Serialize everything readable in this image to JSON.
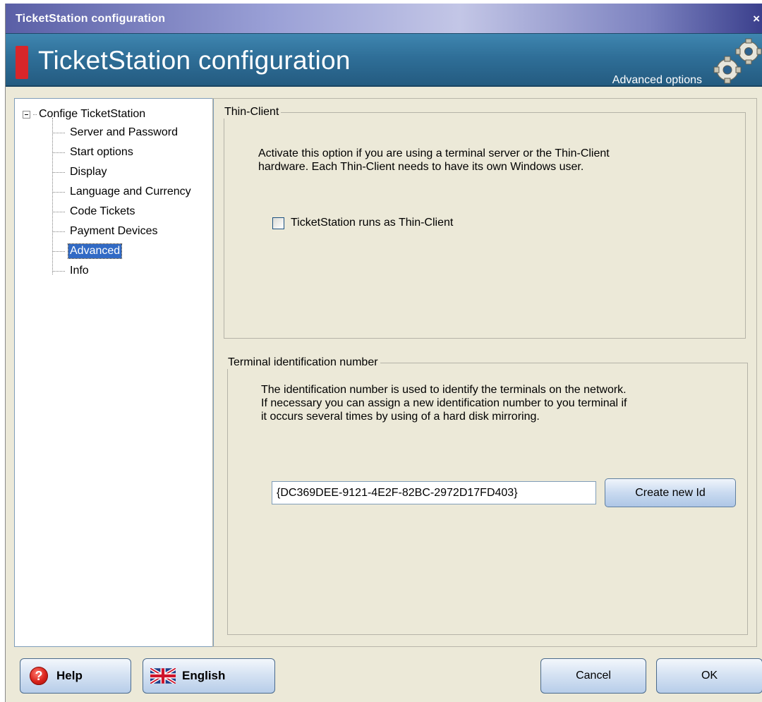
{
  "window": {
    "title": "TicketStation configuration",
    "close_glyph": "×"
  },
  "header": {
    "title": "TicketStation configuration",
    "subtitle": "Advanced options",
    "accent_color": "#d8262a",
    "icon": "gears-icon"
  },
  "tree": {
    "root": "Confige TicketStation",
    "items": [
      {
        "label": "Server and Password"
      },
      {
        "label": "Start options"
      },
      {
        "label": "Display"
      },
      {
        "label": "Language and Currency"
      },
      {
        "label": "Code Tickets"
      },
      {
        "label": "Payment Devices"
      },
      {
        "label": "Advanced",
        "selected": true
      },
      {
        "label": "Info"
      }
    ]
  },
  "thin_client": {
    "legend": "Thin-Client",
    "description_1": "Activate this option if you are using a terminal server or the Thin-Client",
    "description_2": "hardware. Each Thin-Client needs to have its own Windows user.",
    "checkbox_label": "TicketStation runs as Thin-Client",
    "checkbox_checked": false
  },
  "terminal": {
    "legend": "Terminal identification number",
    "description_1": "The identification number is used to identify the terminals on the network.",
    "description_2": "If necessary you can assign a new identification number to you terminal if",
    "description_3": "it occurs several times by using of a hard disk mirroring.",
    "id_value": "{DC369DEE-9121-4E2F-82BC-2972D17FD403}",
    "create_button": "Create new Id"
  },
  "footer": {
    "help": "Help",
    "language": "English",
    "cancel": "Cancel",
    "ok": "OK"
  }
}
